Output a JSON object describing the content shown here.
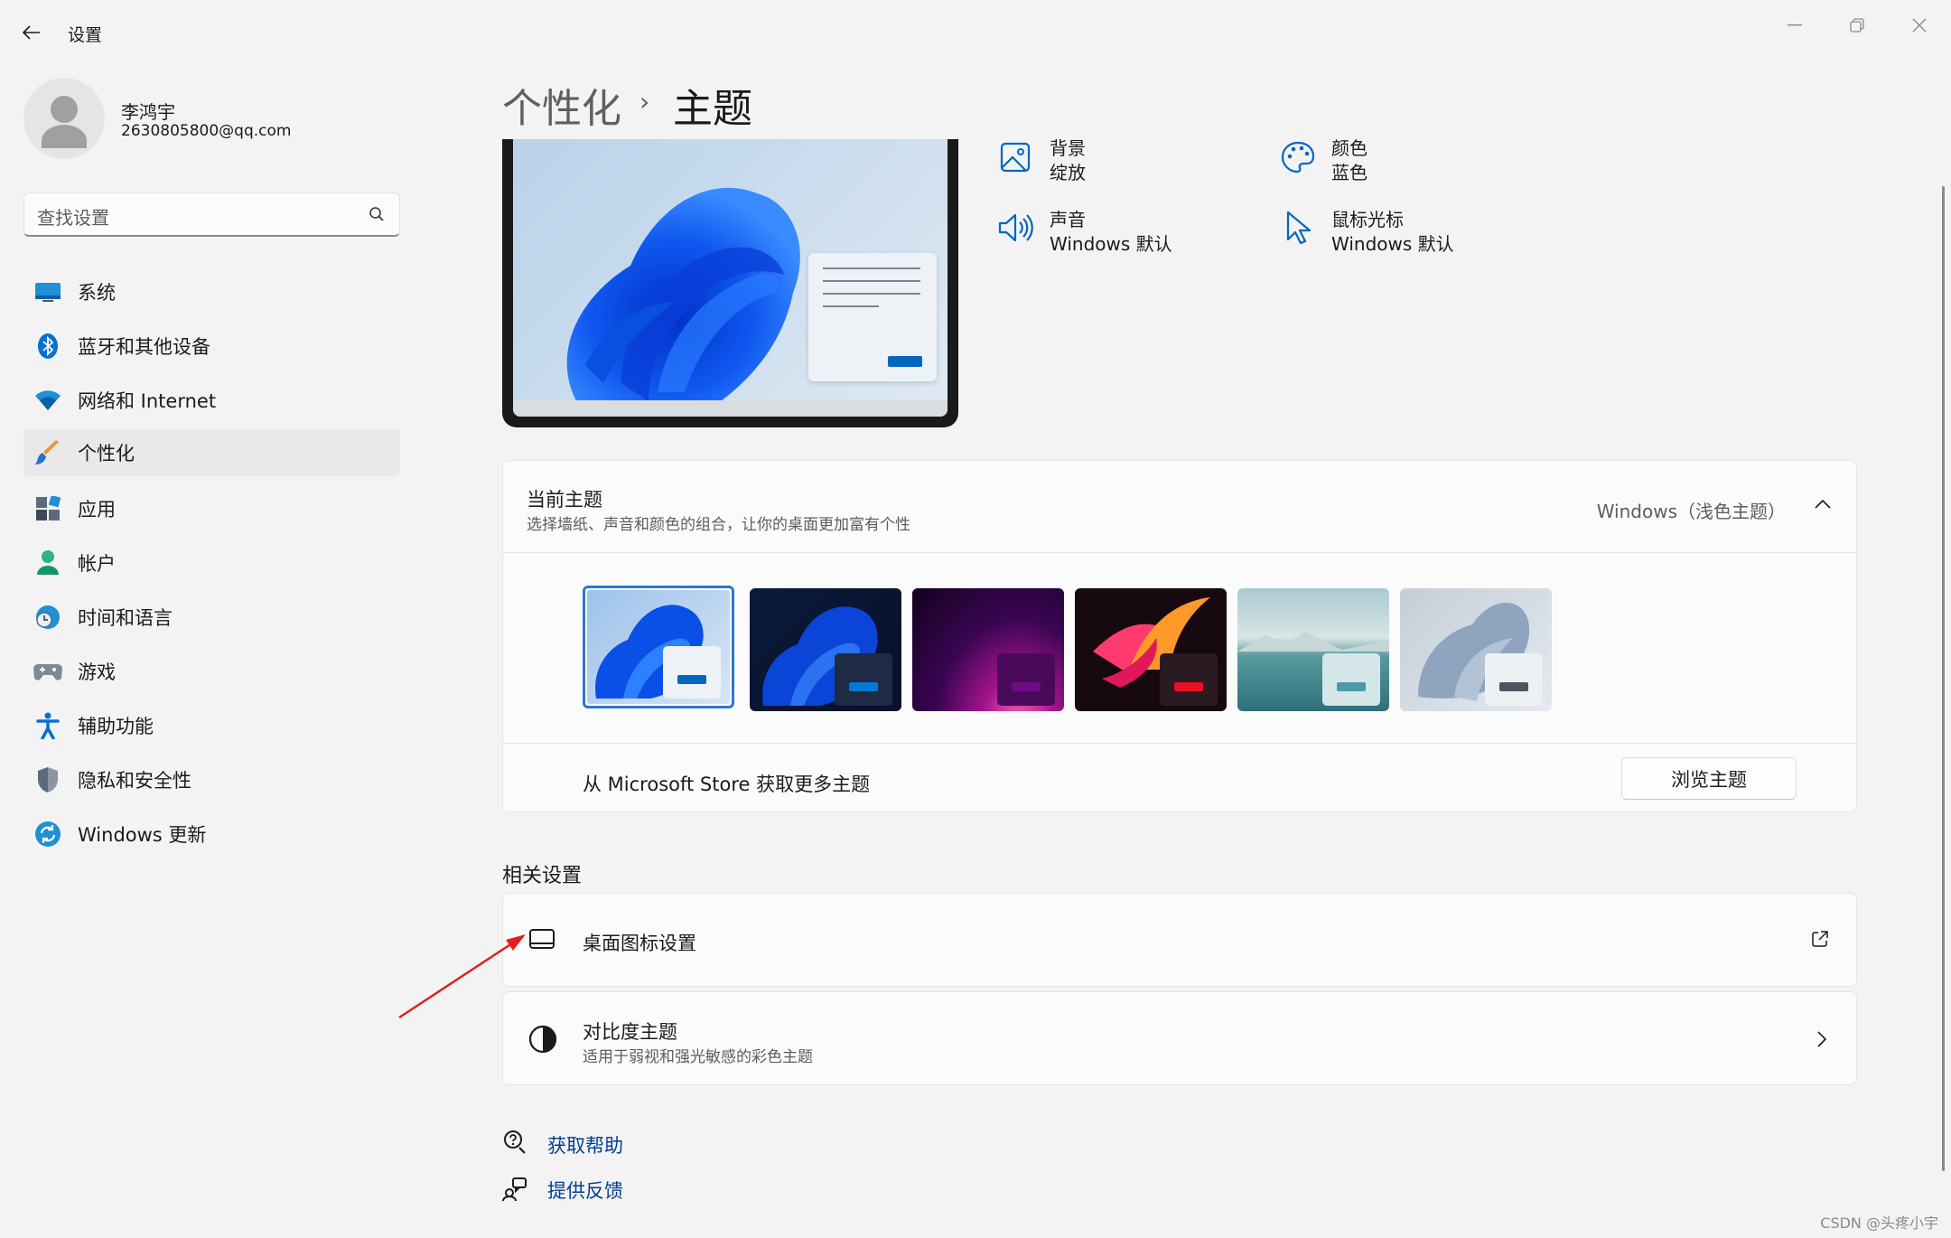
{
  "window": {
    "title": "设置"
  },
  "user": {
    "name": "李鸿宇",
    "email": "2630805800@qq.com"
  },
  "search": {
    "placeholder": "查找设置"
  },
  "nav": [
    {
      "label": "系统",
      "icon": "monitor-icon"
    },
    {
      "label": "蓝牙和其他设备",
      "icon": "bluetooth-icon"
    },
    {
      "label": "网络和 Internet",
      "icon": "wifi-icon"
    },
    {
      "label": "个性化",
      "icon": "brush-icon",
      "active": true
    },
    {
      "label": "应用",
      "icon": "apps-icon"
    },
    {
      "label": "帐户",
      "icon": "person-icon"
    },
    {
      "label": "时间和语言",
      "icon": "globe-clock-icon"
    },
    {
      "label": "游戏",
      "icon": "gamepad-icon"
    },
    {
      "label": "辅助功能",
      "icon": "accessibility-icon"
    },
    {
      "label": "隐私和安全性",
      "icon": "shield-icon"
    },
    {
      "label": "Windows 更新",
      "icon": "refresh-icon"
    }
  ],
  "breadcrumb": {
    "parent": "个性化",
    "separator": "›",
    "current": "主题"
  },
  "theme_props": {
    "background": {
      "label": "背景",
      "value": "绽放"
    },
    "color": {
      "label": "颜色",
      "value": "蓝色"
    },
    "sound": {
      "label": "声音",
      "value": "Windows 默认"
    },
    "cursor": {
      "label": "鼠标光标",
      "value": "Windows 默认"
    }
  },
  "current_theme": {
    "title": "当前主题",
    "subtitle": "选择墙纸、声音和颜色的组合，让你的桌面更加富有个性",
    "value": "Windows（浅色主题）"
  },
  "themes": [
    {
      "name": "windows-light",
      "accent": "#0067c0",
      "selected": true
    },
    {
      "name": "windows-dark",
      "accent": "#0078d4"
    },
    {
      "name": "glow",
      "accent": "#6b0b82"
    },
    {
      "name": "captured-motion",
      "accent": "#e81123"
    },
    {
      "name": "sunrise",
      "accent": "#4a9aa8"
    },
    {
      "name": "flow",
      "accent": "#4a5560"
    }
  ],
  "store": {
    "text": "从 Microsoft Store 获取更多主题",
    "button": "浏览主题"
  },
  "related": {
    "title": "相关设置",
    "desktop_icons": {
      "label": "桌面图标设置"
    },
    "contrast": {
      "title": "对比度主题",
      "subtitle": "适用于弱视和强光敏感的彩色主题"
    }
  },
  "help": {
    "get_help": "获取帮助",
    "feedback": "提供反馈"
  },
  "watermark": "CSDN @头疼小宇"
}
